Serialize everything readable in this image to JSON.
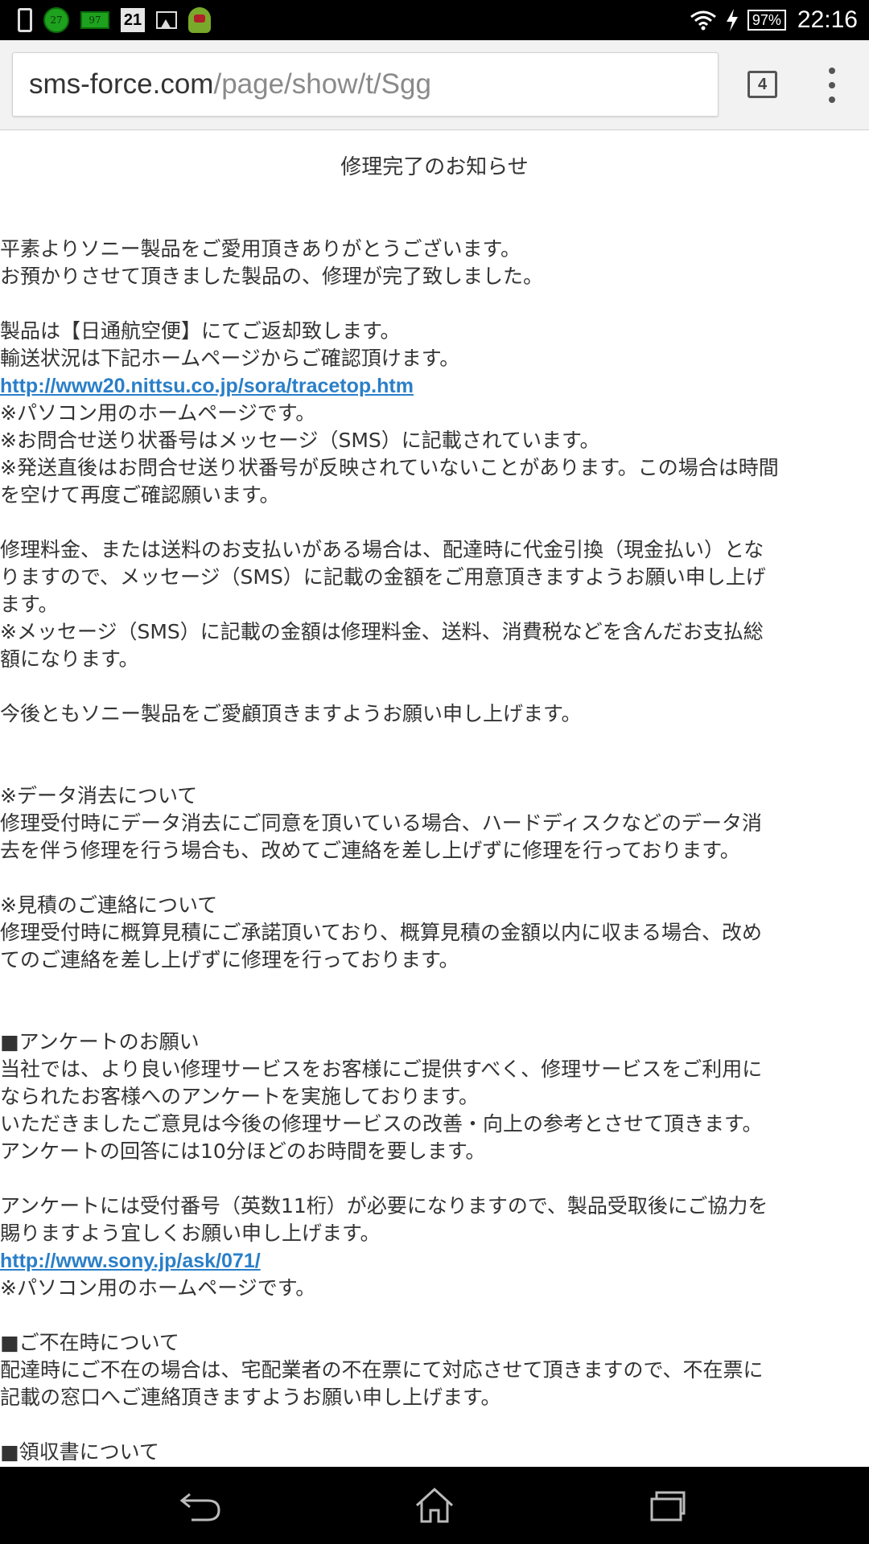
{
  "status_bar": {
    "notif_circle": "27",
    "notif_battery": "97",
    "calendar_day": "21",
    "battery": "97%",
    "time": "22:16"
  },
  "toolbar": {
    "url_domain": "sms-force.com",
    "url_path": "/page/show/t/Sgg",
    "tab_count": "4"
  },
  "page": {
    "title": "修理完了のお知らせ",
    "p1": "平素よりソニー製品をご愛用頂きありがとうございます。\nお預かりさせて頂きました製品の、修理が完了致しました。",
    "p2": "製品は【日通航空便】にてご返却致します。\n輸送状況は下記ホームページからご確認頂けます。",
    "link1": "http://www20.nittsu.co.jp/sora/tracetop.htm",
    "p3": "※パソコン用のホームページです。\n※お問合せ送り状番号はメッセージ（SMS）に記載されています。\n※発送直後はお問合せ送り状番号が反映されていないことがあります。この場合は時間\nを空けて再度ご確認願います。",
    "p4": "修理料金、または送料のお支払いがある場合は、配達時に代金引換（現金払い）とな\nりますので、メッセージ（SMS）に記載の金額をご用意頂きますようお願い申し上げ\nます。\n※メッセージ（SMS）に記載の金額は修理料金、送料、消費税などを含んだお支払総\n額になります。",
    "p5": "今後ともソニー製品をご愛顧頂きますようお願い申し上げます。",
    "p6": "※データ消去について\n修理受付時にデータ消去にご同意を頂いている場合、ハードディスクなどのデータ消\n去を伴う修理を行う場合も、改めてご連絡を差し上げずに修理を行っております。",
    "p7": "※見積のご連絡について\n修理受付時に概算見積にご承諾頂いており、概算見積の金額以内に収まる場合、改め\nてのご連絡を差し上げずに修理を行っております。",
    "p8": "■アンケートのお願い\n当社では、より良い修理サービスをお客様にご提供すべく、修理サービスをご利用に\nなられたお客様へのアンケートを実施しております。\nいただきましたご意見は今後の修理サービスの改善・向上の参考とさせて頂きます。\nアンケートの回答には10分ほどのお時間を要します。",
    "p9": "アンケートには受付番号（英数11桁）が必要になりますので、製品受取後にご協力を\n賜りますよう宜しくお願い申し上げます。",
    "link2": "http://www.sony.jp/ask/071/",
    "p10": "※パソコン用のホームページです。",
    "p11": "■ご不在時について\n配達時にご不在の場合は、宅配業者の不在票にて対応させて頂きますので、不在票に\n記載の窓口へご連絡頂きますようお願い申し上げます。",
    "p12": "■領収書について"
  },
  "colors": {
    "link": "#2a7fc8",
    "text": "#333333",
    "status_bar": "#000000",
    "toolbar": "#f2f2f2"
  },
  "icons": {
    "status_left": [
      "phone-icon",
      "notification-circle-icon",
      "battery-app-icon",
      "calendar-icon",
      "image-icon",
      "android-icon"
    ],
    "status_right": [
      "wifi-icon",
      "charging-icon",
      "battery-icon"
    ],
    "nav": [
      "back-icon",
      "home-icon",
      "recents-icon"
    ]
  }
}
